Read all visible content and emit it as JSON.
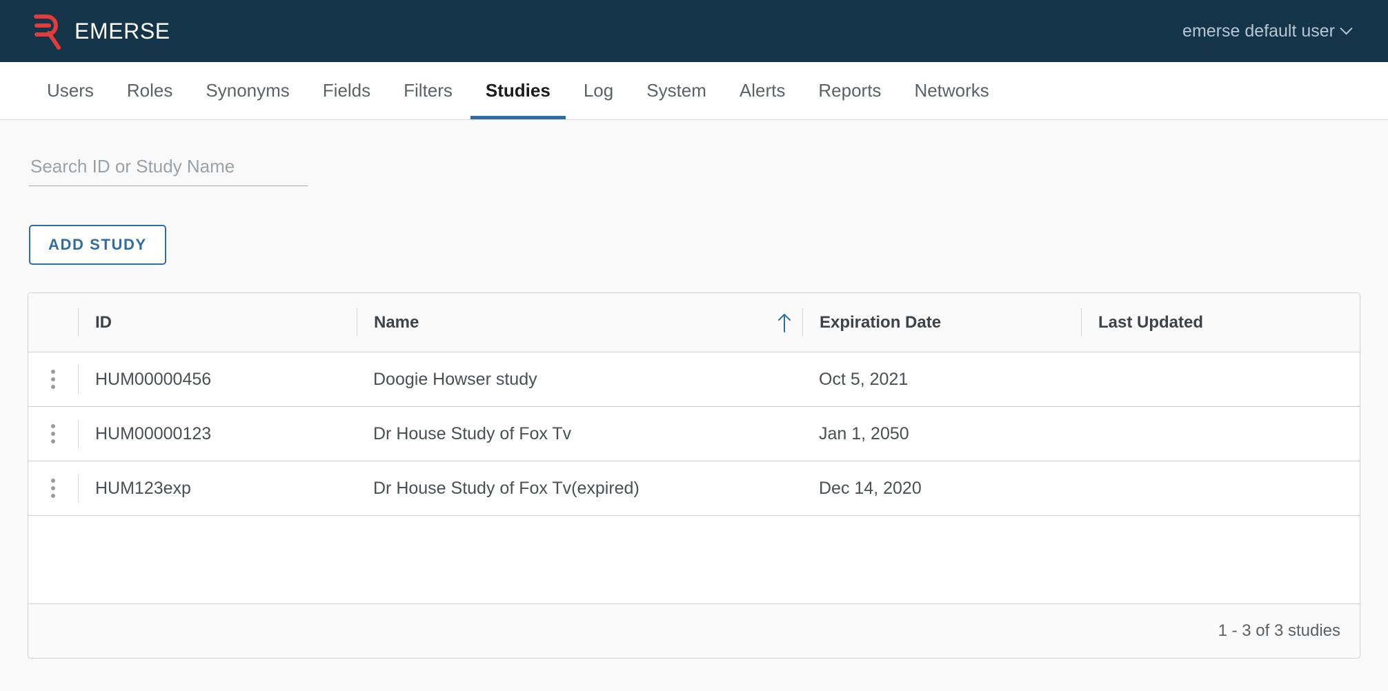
{
  "header": {
    "brand_name": "EMERSE",
    "logo_icon": "emerse-logo-icon",
    "user_label": "emerse default user",
    "chevron_icon": "chevron-down-icon",
    "bg_color": "#143449",
    "brand_color": "#e03c3c"
  },
  "nav": {
    "items": [
      {
        "label": "Users",
        "active": false
      },
      {
        "label": "Roles",
        "active": false
      },
      {
        "label": "Synonyms",
        "active": false
      },
      {
        "label": "Fields",
        "active": false
      },
      {
        "label": "Filters",
        "active": false
      },
      {
        "label": "Studies",
        "active": true
      },
      {
        "label": "Log",
        "active": false
      },
      {
        "label": "System",
        "active": false
      },
      {
        "label": "Alerts",
        "active": false
      },
      {
        "label": "Reports",
        "active": false
      },
      {
        "label": "Networks",
        "active": false
      }
    ],
    "active_color": "#2e6da4"
  },
  "search": {
    "placeholder": "Search ID or Study Name",
    "value": ""
  },
  "actions": {
    "add_study_label": "ADD STUDY",
    "accent_color": "#2e6da4"
  },
  "table": {
    "columns": [
      {
        "key": "menu",
        "label": ""
      },
      {
        "key": "id",
        "label": "ID"
      },
      {
        "key": "name",
        "label": "Name"
      },
      {
        "key": "expiration_date",
        "label": "Expiration Date"
      },
      {
        "key": "last_updated",
        "label": "Last Updated"
      }
    ],
    "sort": {
      "column": "name",
      "direction": "asc",
      "icon": "arrow-up-icon",
      "color": "#2e6da4"
    },
    "row_menu_icon": "kebab-menu-icon",
    "rows": [
      {
        "id": "HUM00000456",
        "name": "Doogie Howser study",
        "expiration_date": "Oct 5, 2021",
        "last_updated": ""
      },
      {
        "id": "HUM00000123",
        "name": "Dr House Study of Fox Tv",
        "expiration_date": "Jan 1, 2050",
        "last_updated": ""
      },
      {
        "id": "HUM123exp",
        "name": "Dr House Study of Fox Tv(expired)",
        "expiration_date": "Dec 14, 2020",
        "last_updated": ""
      }
    ],
    "footer_text": "1 - 3 of 3 studies"
  }
}
